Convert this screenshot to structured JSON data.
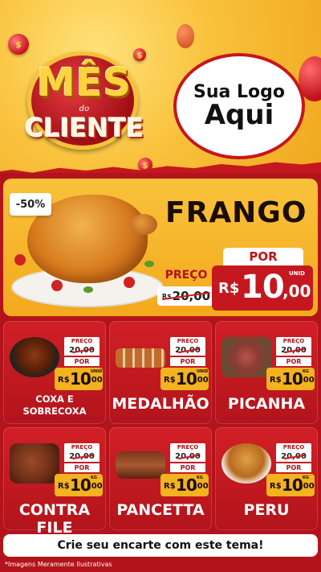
{
  "header": {
    "badge_top": "MÊS",
    "badge_mid": "do",
    "badge_bottom": "CLIENTE",
    "logo_line1": "Sua Logo",
    "logo_line2": "Aqui"
  },
  "coin_symbol": "$",
  "featured": {
    "discount": "-50%",
    "name": "FRANGO",
    "preco_label": "PREÇO",
    "old_currency": "R$",
    "old_price": "20,00",
    "por_label": "POR",
    "currency": "R$",
    "price_int": "10",
    "price_cents": ",00",
    "unit": "UNID"
  },
  "products": [
    {
      "name": "COXA E SOBRECOXA",
      "preco_label": "PREÇO",
      "old_price": "20,00",
      "por_label": "POR",
      "currency": "R$",
      "price_int": "10",
      "price_cents": ",00",
      "unit": "UNID"
    },
    {
      "name": "MEDALHÃO",
      "preco_label": "PREÇO",
      "old_price": "20,00",
      "por_label": "POR",
      "currency": "R$",
      "price_int": "10",
      "price_cents": ",00",
      "unit": "UNID"
    },
    {
      "name": "PICANHA",
      "preco_label": "PREÇO",
      "old_price": "20,00",
      "por_label": "POR",
      "currency": "R$",
      "price_int": "10",
      "price_cents": ",00",
      "unit": "KG"
    },
    {
      "name": "CONTRA FILE",
      "preco_label": "PREÇO",
      "old_price": "20,00",
      "por_label": "POR",
      "currency": "R$",
      "price_int": "10",
      "price_cents": ",00",
      "unit": "KG"
    },
    {
      "name": "PANCETTA",
      "preco_label": "PREÇO",
      "old_price": "20,00",
      "por_label": "POR",
      "currency": "R$",
      "price_int": "10",
      "price_cents": ",00",
      "unit": "KG"
    },
    {
      "name": "PERU",
      "preco_label": "PREÇO",
      "old_price": "20,00",
      "por_label": "POR",
      "currency": "R$",
      "price_int": "10",
      "price_cents": ",00",
      "unit": "KG"
    }
  ],
  "cta": "Crie seu encarte com este tema!",
  "footnote": "*Imagens Meramente Ilustrativas",
  "colors": {
    "red": "#c4171f",
    "yellow": "#f9c23c",
    "dark_red": "#b3141b"
  }
}
